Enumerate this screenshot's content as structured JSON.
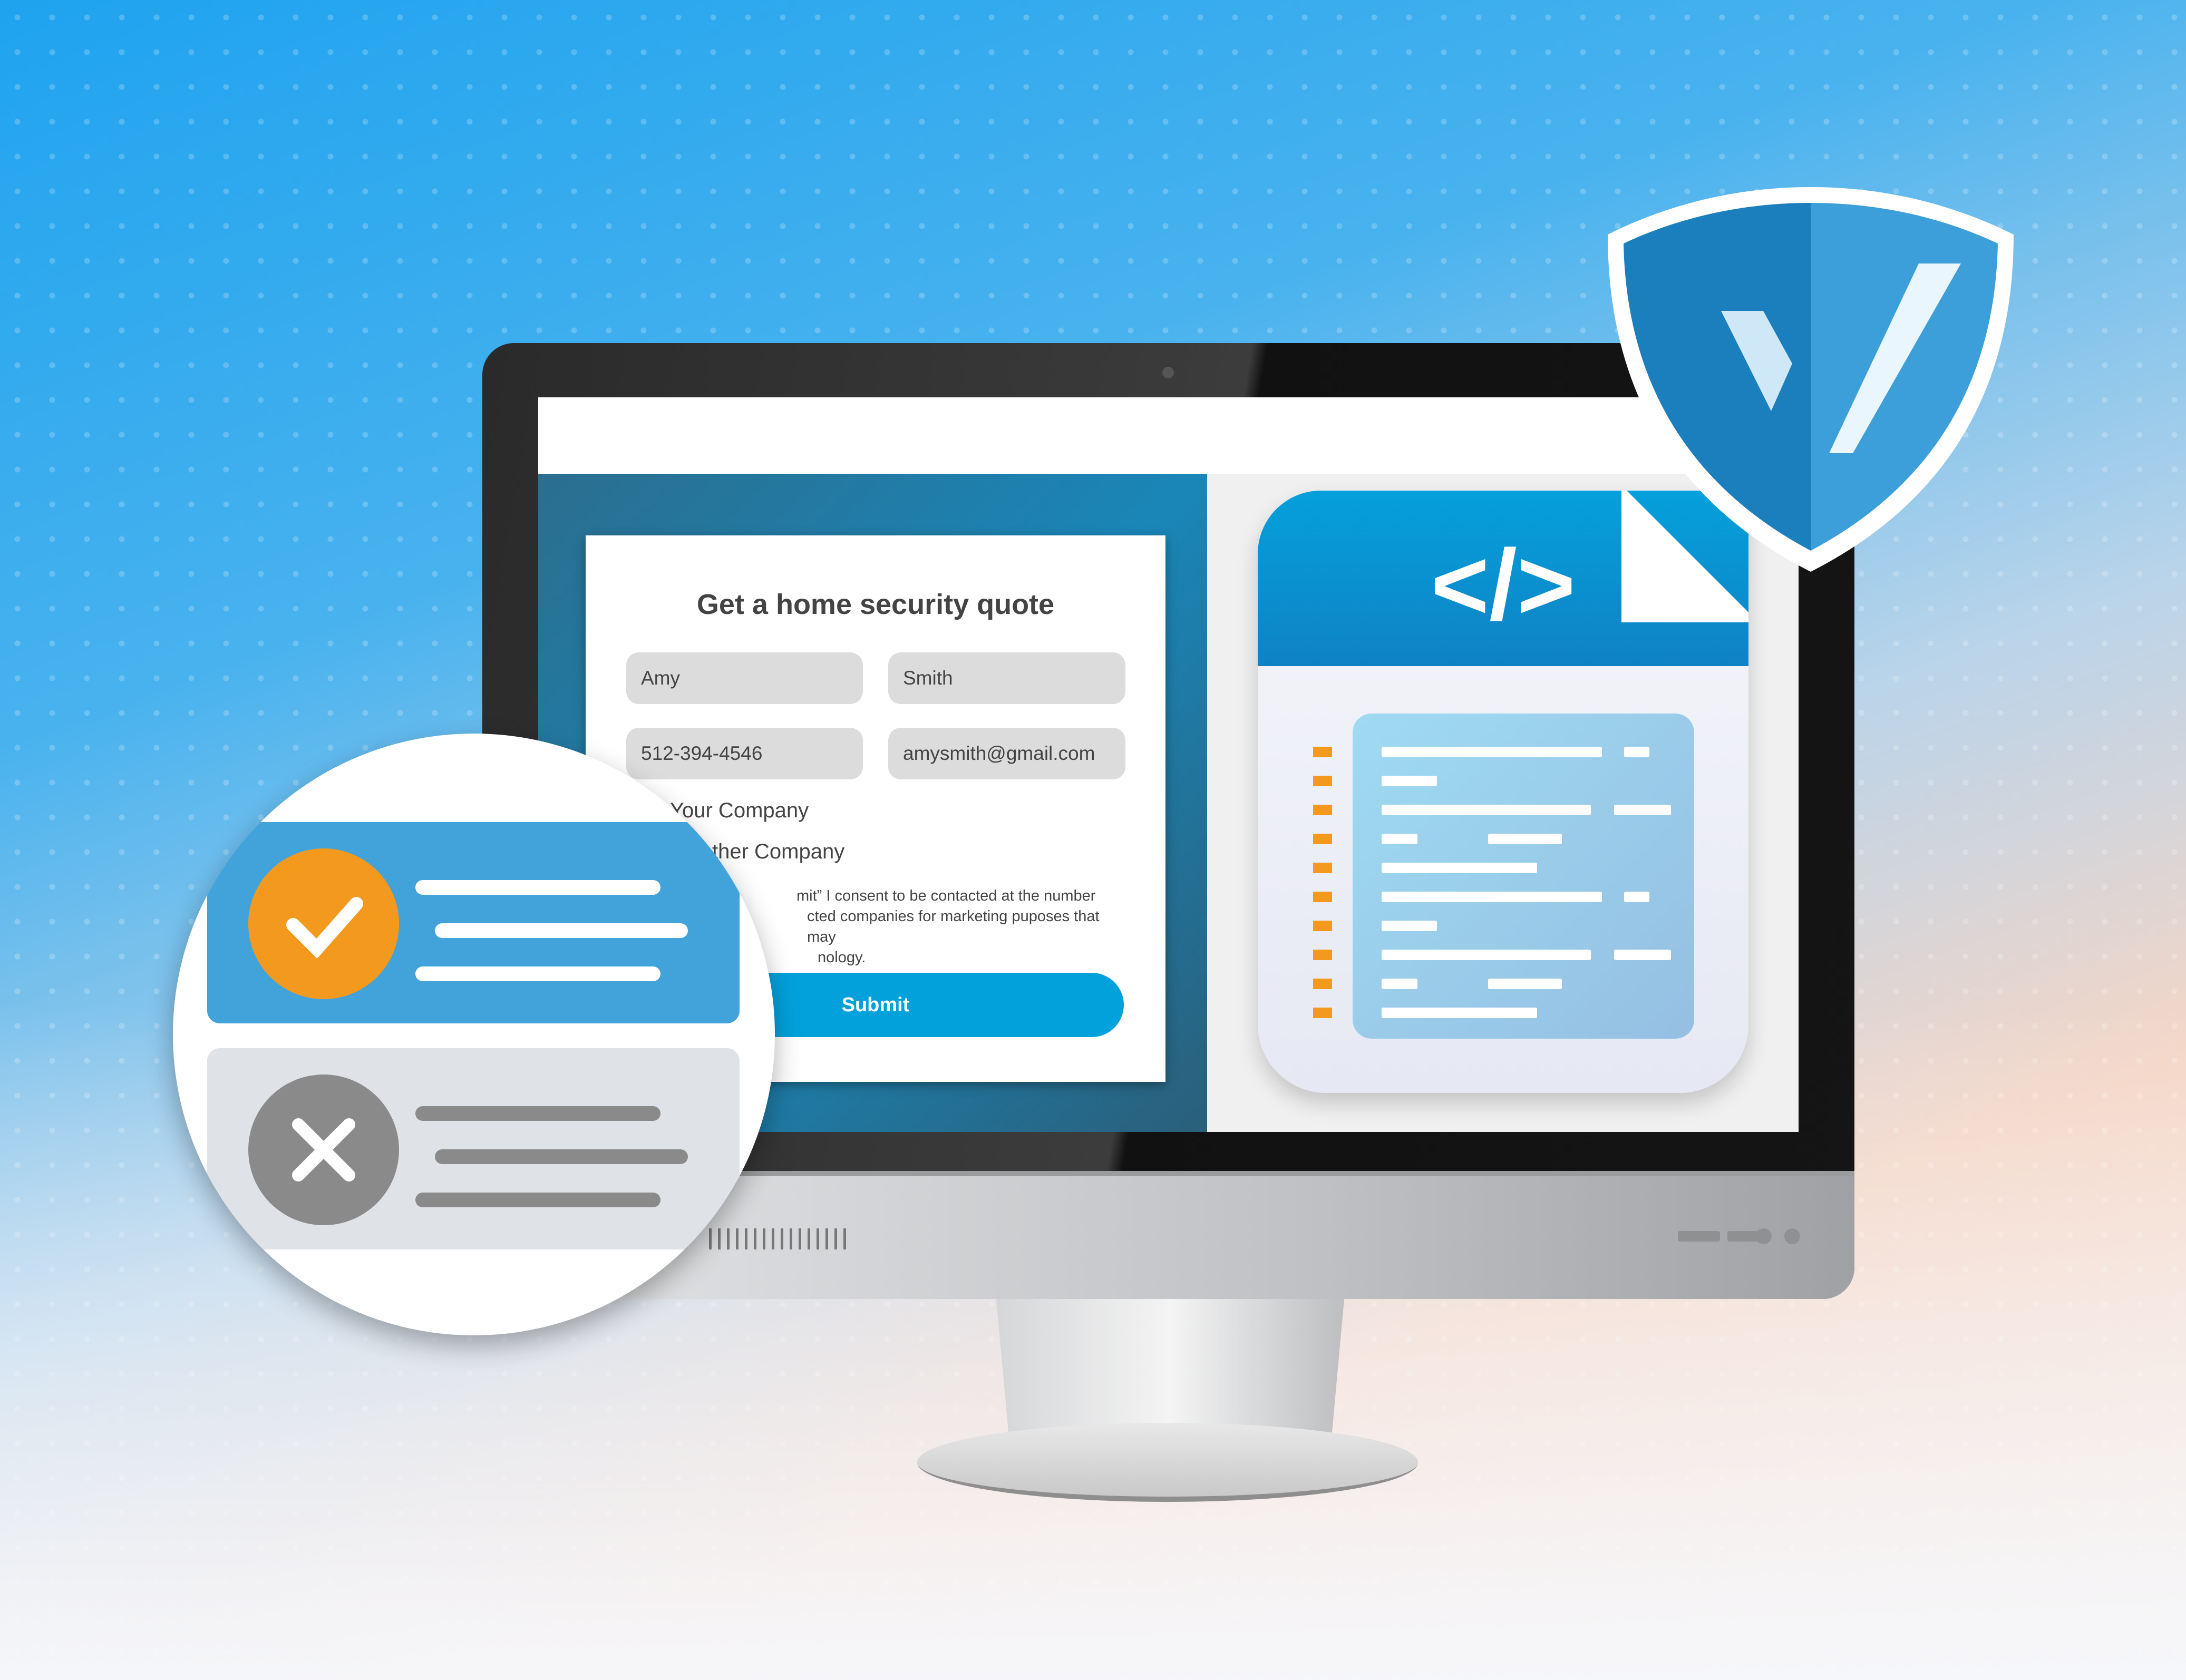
{
  "colors": {
    "accent_blue": "#03a1dc",
    "success_orange": "#f39a1e",
    "shield_blue": "#1b7fbd",
    "error_gray": "#8a8a8a"
  },
  "form": {
    "title": "Get a home security quote",
    "first_name": "Amy",
    "last_name": "Smith",
    "phone": "512-394-4546",
    "email": "amysmith@gmail.com",
    "option_1": "Your Company",
    "option_2": "ther Company",
    "consent_lines": [
      "mit” I consent to be contacted at the number",
      "cted companies for marketing puposes that may",
      "nology."
    ],
    "submit_label": "Submit"
  },
  "code_document": {
    "icon": "code-icon",
    "glyph": "</>"
  },
  "shield": {
    "icon": "shield-check-icon"
  },
  "status_list": {
    "items": [
      {
        "status": "success",
        "icon": "check-icon"
      },
      {
        "status": "error",
        "icon": "x-icon"
      }
    ]
  }
}
